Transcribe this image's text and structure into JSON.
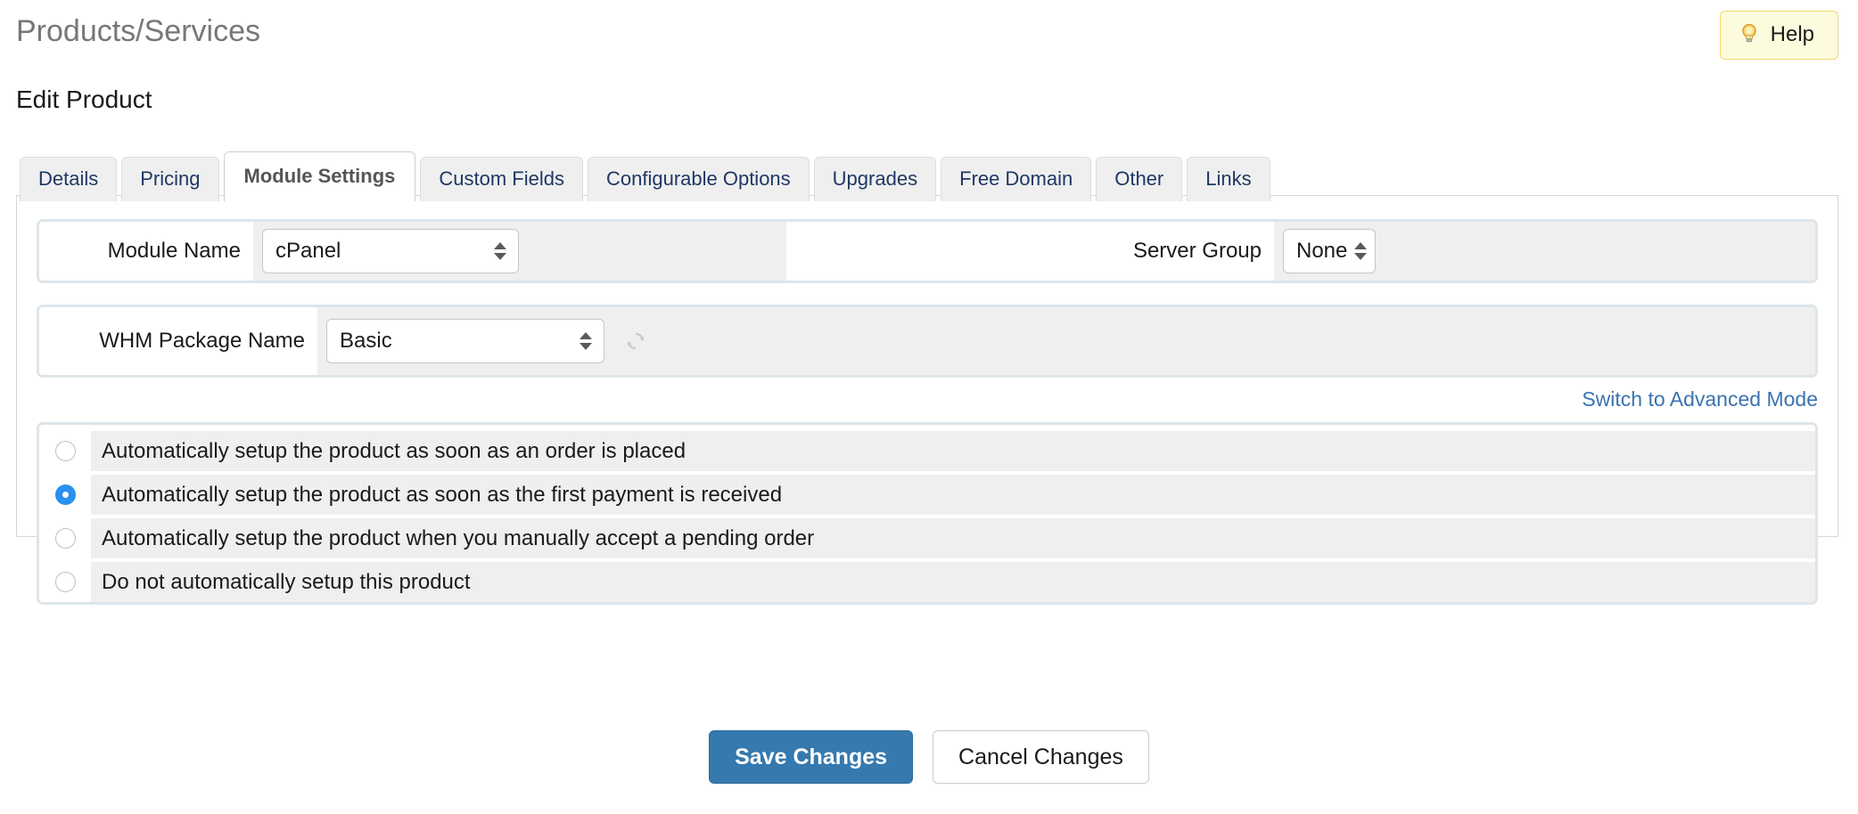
{
  "header": {
    "title": "Products/Services",
    "subtitle": "Edit Product",
    "help_label": "Help",
    "help_icon": "lightbulb-icon"
  },
  "tabs": [
    {
      "label": "Details",
      "active": false
    },
    {
      "label": "Pricing",
      "active": false
    },
    {
      "label": "Module Settings",
      "active": true
    },
    {
      "label": "Custom Fields",
      "active": false
    },
    {
      "label": "Configurable Options",
      "active": false
    },
    {
      "label": "Upgrades",
      "active": false
    },
    {
      "label": "Free Domain",
      "active": false
    },
    {
      "label": "Other",
      "active": false
    },
    {
      "label": "Links",
      "active": false
    }
  ],
  "module_settings": {
    "module_name_label": "Module Name",
    "module_name_value": "cPanel",
    "server_group_label": "Server Group",
    "server_group_value": "None",
    "whm_package_label": "WHM Package Name",
    "whm_package_value": "Basic",
    "refresh_icon": "refresh-icon",
    "advanced_mode_link": "Switch to Advanced Mode",
    "setup_options": [
      {
        "label": "Automatically setup the product as soon as an order is placed",
        "selected": false
      },
      {
        "label": "Automatically setup the product as soon as the first payment is received",
        "selected": true
      },
      {
        "label": "Automatically setup the product when you manually accept a pending order",
        "selected": false
      },
      {
        "label": "Do not automatically setup this product",
        "selected": false
      }
    ]
  },
  "footer": {
    "save_label": "Save Changes",
    "cancel_label": "Cancel Changes"
  },
  "colors": {
    "link": "#3a73b0",
    "primary_button": "#3579ae",
    "radio_selected": "#2a90f0",
    "help_background": "#fdfbdd",
    "help_border": "#f0d96b"
  }
}
